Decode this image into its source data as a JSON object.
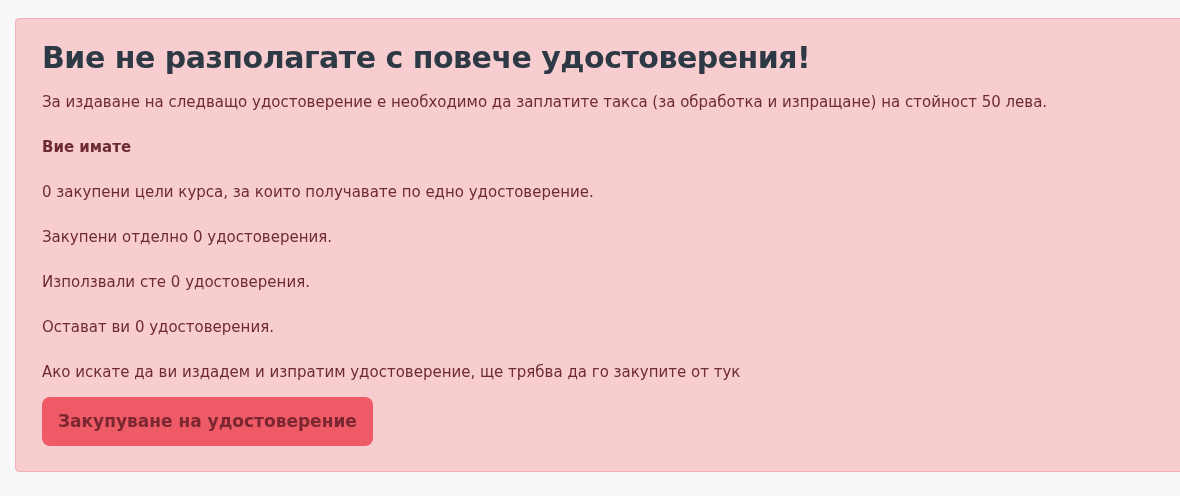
{
  "alert": {
    "title": "Вие не разполагате с повече удостоверения!",
    "paragraphs": [
      {
        "text": "За издаване на следващо удостоверение е необходимо да заплатите такса (за обработка и изпращане) на стойност 50 лева.",
        "bold": false
      },
      {
        "text": "Вие имате",
        "bold": true
      },
      {
        "text": "0 закупени цели курса, за които получавате по едно удостоверение.",
        "bold": false
      },
      {
        "text": "Закупени отделно 0 удостоверения.",
        "bold": false
      },
      {
        "text": "Използвали сте 0 удостоверения.",
        "bold": false
      },
      {
        "text": "Остават ви 0 удостоверения.",
        "bold": false
      },
      {
        "text": "Ако искате да ви издадем и изпратим удостоверение, ще трябва да го закупите от тук",
        "bold": false
      }
    ],
    "button": "Закупуване на удостоверение"
  }
}
